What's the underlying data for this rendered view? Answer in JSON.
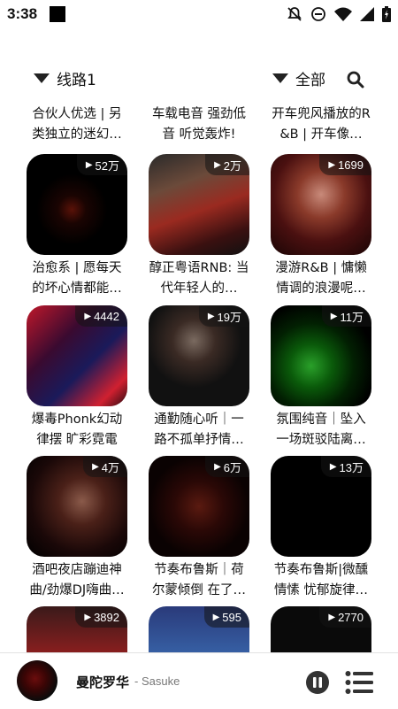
{
  "status_bar": {
    "time": "3:38",
    "icons": [
      "notifications-off-icon",
      "do-not-disturb-icon",
      "wifi-icon",
      "signal-icon",
      "battery-icon"
    ]
  },
  "filters": {
    "route_label": "线路1",
    "category_label": "全部",
    "search_icon": "search-icon"
  },
  "playlists": [
    {
      "title": "合伙人优选 | 另类独立的迷幻…",
      "plays": ""
    },
    {
      "title": "车载电音 强劲低音 听觉轰炸!",
      "plays": ""
    },
    {
      "title": "开车兜风播放的R&B | 开车像…",
      "plays": ""
    },
    {
      "title": "治愈系 | 愿每天的坏心情都能…",
      "plays": "52万"
    },
    {
      "title": "醇正粤语RNB: 当代年轻人的…",
      "plays": "2万"
    },
    {
      "title": "漫游R&B | 慵懒情调的浪漫呢…",
      "plays": "1699"
    },
    {
      "title": "爆毒Phonk幻动律摆 旷彩霓電",
      "plays": "4442"
    },
    {
      "title": "通勤随心听｜一路不孤单抒情…",
      "plays": "19万"
    },
    {
      "title": "氛围纯音｜坠入一场斑驳陆离…",
      "plays": "11万"
    },
    {
      "title": "酒吧夜店蹦迪神曲/劲爆DJ嗨曲…",
      "plays": "4万"
    },
    {
      "title": "节奏布鲁斯｜荷尔蒙倾倒 在了…",
      "plays": "6万"
    },
    {
      "title": "节奏布鲁斯|微醺情愫 忧郁旋律…",
      "plays": "13万"
    },
    {
      "title": "",
      "plays": "3892"
    },
    {
      "title": "",
      "plays": "595"
    },
    {
      "title": "",
      "plays": "2770"
    }
  ],
  "player": {
    "song_title": "曼陀罗华",
    "artist": "- Sasuke"
  },
  "colors": {
    "background": "#ffffff",
    "text": "#111111",
    "badge": "#141414",
    "muted": "#777777"
  }
}
